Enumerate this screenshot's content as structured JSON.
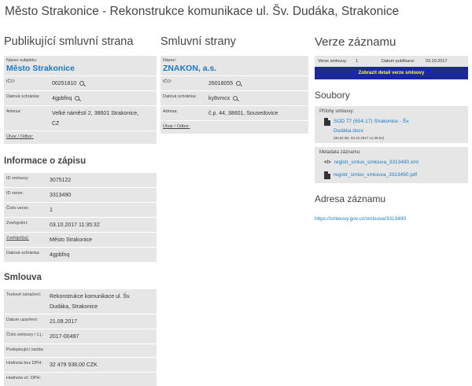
{
  "page_title": "Město Strakonice - Rekonstrukce komunikace ul. Šv. Dudáka, Strakonice",
  "publisher": {
    "heading": "Publikující smluvní strana",
    "name_label": "Název subjektu:",
    "name": "Město Strakonice",
    "ico_label": "IČO:",
    "ico": "00251810",
    "ds_label": "Datová schránka:",
    "ds": "4gpbfnq",
    "address_label": "Adresa:",
    "address": "Velké náměstí 2, 38601 Strakonice, CZ",
    "unit_label": "Útvar / Odbor:"
  },
  "parties": {
    "heading": "Smluvní strany",
    "name_label": "Název:",
    "name": "ZNAKON, a.s.",
    "ico_label": "IČO:",
    "ico": "26018055",
    "ds_label": "Datová schránka:",
    "ds": "ky8vmcx",
    "address_label": "Adresa:",
    "address": "č.p. 44, 38601, Sousedovice",
    "unit_label": "Útvar / Odbor:"
  },
  "info": {
    "heading": "Informace o zápisu",
    "rows": [
      {
        "label": "ID smlouvy:",
        "value": "3075122"
      },
      {
        "label": "ID verze:",
        "value": "3313490"
      },
      {
        "label": "Číslo verze:",
        "value": "1"
      },
      {
        "label": "Zveřejnění:",
        "value": "03.10.2017 11:35:32"
      },
      {
        "label": "Zveřejnil(a):",
        "value": "Město Strakonice"
      },
      {
        "label": "Datová schránka:",
        "value": "4gpbfnq"
      }
    ]
  },
  "contract": {
    "heading": "Smlouva",
    "rows": [
      {
        "label": "Textové označení:",
        "value": "Rekonstrukce komunikace ul. Šv. Dudáka, Strakonice"
      },
      {
        "label": "Datum uzavření:",
        "value": "21.09.2017"
      },
      {
        "label": "Číslo smlouvy / č.j.:",
        "value": "2017-00497"
      },
      {
        "label": "Podepisující osoba:",
        "value": ""
      },
      {
        "label": "Hodnota bez DPH:",
        "value": "32 479 938,00 CZK"
      },
      {
        "label": "Hodnota vč. DPH:",
        "value": ""
      }
    ]
  },
  "version": {
    "heading": "Verze záznamu",
    "version_label": "Verze smlouvy:",
    "version_value": "1",
    "date_label": "Datum publikace:",
    "date_value": "03.10.2017",
    "detail_button": "Zobrazit detail verze smlouvy"
  },
  "files": {
    "heading": "Soubory",
    "attachments_label": "Přílohy smlouvy:",
    "attachment": {
      "name": "SOD 77 (654-17) Strakonice - Šv. Dudáka.docx",
      "meta": "(80,92 kB, 03.10.2017 11:35:54)"
    },
    "metadata_label": "Metadata záznamu:",
    "xml": "registr_smluv_smlouva_3313490.xml",
    "pdf": "registr_smluv_smlouva_3313490.pdf"
  },
  "record_address": {
    "heading": "Adresa záznamu",
    "url": "https://smlouvy.gov.cz/smlouva/3313490"
  }
}
